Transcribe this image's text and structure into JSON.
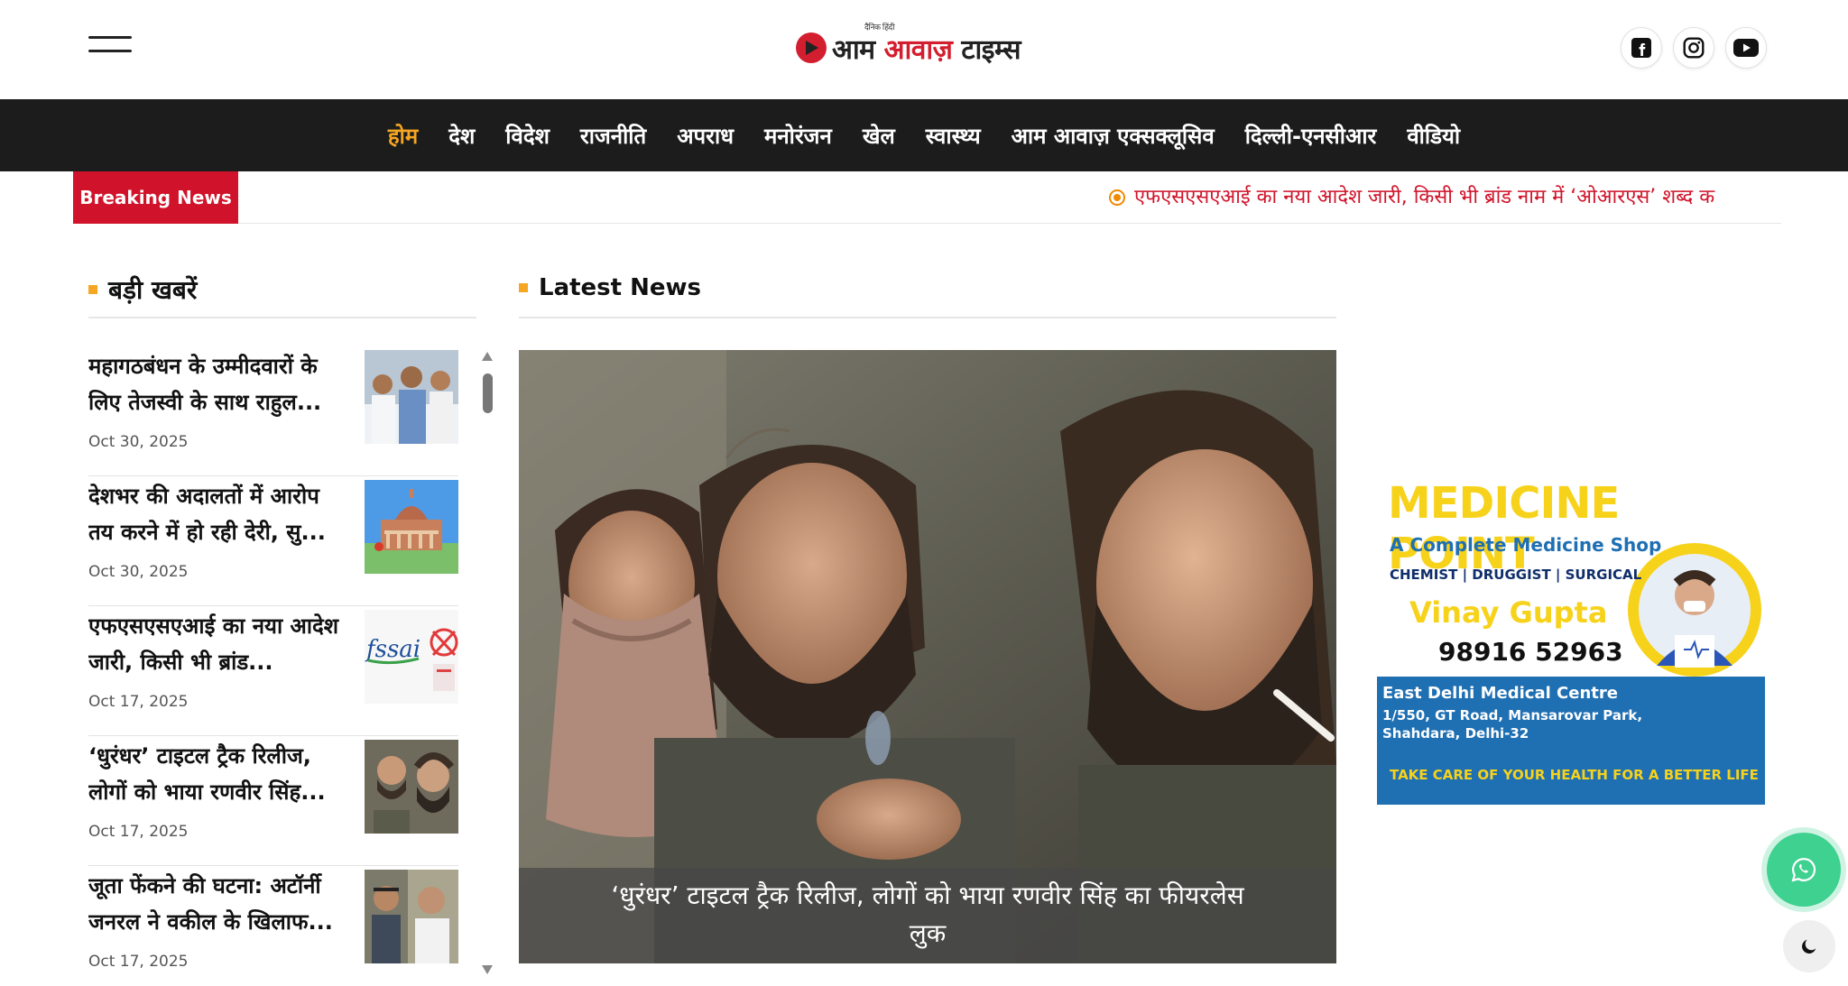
{
  "header": {
    "logo_tagline": "दैनिक हिंदी",
    "logo_word1": "आम",
    "logo_word2": "आवाज़",
    "logo_word3": "टाइम्स",
    "social": [
      "facebook-icon",
      "instagram-icon",
      "youtube-icon"
    ]
  },
  "nav": {
    "items": [
      "होम",
      "देश",
      "विदेश",
      "राजनीति",
      "अपराध",
      "मनोरंजन",
      "खेल",
      "स्वास्थ्य",
      "आम आवाज़ एक्सक्लूसिव",
      "दिल्ली-एनसीआर",
      "वीडियो"
    ],
    "active_index": 0
  },
  "breaking": {
    "label": "Breaking News",
    "ticker": "एफएसएसएआई का नया आदेश जारी, किसी भी ब्रांड नाम में ‘ओआरएस’ शब्द क"
  },
  "top_news": {
    "title": "बड़ी खबरें",
    "items": [
      {
        "title": "महागठबंधन के उम्मीदवारों के लिए तेजस्वी के साथ राहुल...",
        "date": "Oct 30, 2025"
      },
      {
        "title": "देशभर की अदालतों में आरोप तय करने में हो रही देरी, सु...",
        "date": "Oct 30, 2025"
      },
      {
        "title": "एफएसएसएआई का नया आदेश जारी, किसी भी ब्रांड...",
        "date": "Oct 17, 2025"
      },
      {
        "title": "‘धुरंधर’ टाइटल ट्रैक रिलीज, लोगों को भाया रणवीर सिंह...",
        "date": "Oct 17, 2025"
      },
      {
        "title": "जूता फेंकने की घटना: अटॉर्नी जनरल ने वकील के खिलाफ...",
        "date": "Oct 17, 2025"
      }
    ]
  },
  "latest": {
    "title": "Latest News",
    "caption": "‘धुरंधर’ टाइटल ट्रैक रिलीज, लोगों को भाया रणवीर सिंह का फीयरलेस लुक"
  },
  "ad": {
    "title": "MEDICINE POINT",
    "subtitle": "A Complete Medicine Shop",
    "tags": "CHEMIST | DRUGGIST | SURGICAL",
    "name": "Vinay Gupta",
    "phone": "98916 52963",
    "centre": "East Delhi Medical Centre",
    "address1": "1/550, GT Road, Mansarovar Park,",
    "address2": "Shahdara, Delhi-32",
    "slogan": "TAKE CARE OF YOUR HEALTH FOR A BETTER LIFE",
    "colors": {
      "yellow": "#f7d21b",
      "blue": "#1f6fb3",
      "navy": "#0f2e6b"
    }
  },
  "colors": {
    "accent": "#f5a623",
    "breaking": "#d0132a",
    "nav_bg": "#1c1c1c",
    "whatsapp": "#3ed190"
  }
}
